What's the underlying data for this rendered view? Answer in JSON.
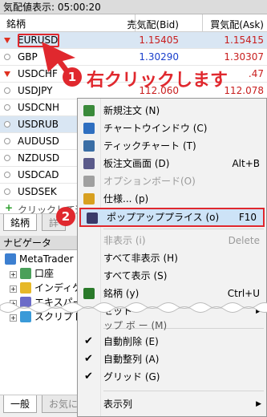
{
  "market_watch": {
    "title": "気配値表示: 05:00:20",
    "columns": [
      "銘柄",
      "売気配(Bid)",
      "買気配(Ask)"
    ],
    "rows": [
      {
        "symbol": "EURUSD",
        "bid": "1.15405",
        "ask": "1.15415",
        "trend": "down",
        "bid_color": "red",
        "ask_color": "red"
      },
      {
        "symbol": "GBP",
        "bid": "1.30290",
        "ask": "1.30307",
        "trend": "neutral",
        "bid_color": "blue",
        "ask_color": "red"
      },
      {
        "symbol": "USDCHF",
        "bid": "",
        "ask": ".47",
        "trend": "down",
        "bid_color": "red",
        "ask_color": "red"
      },
      {
        "symbol": "USDJPY",
        "bid": "112.060",
        "ask": "112.078",
        "trend": "neutral",
        "bid_color": "red",
        "ask_color": "red"
      },
      {
        "symbol": "USDCNH",
        "bid": "",
        "ask": "",
        "trend": "neutral"
      },
      {
        "symbol": "USDRUB",
        "bid": "",
        "ask": "",
        "trend": "neutral"
      },
      {
        "symbol": "AUDUSD",
        "bid": "",
        "ask": "",
        "trend": "neutral"
      },
      {
        "symbol": "NZDUSD",
        "bid": "",
        "ask": "",
        "trend": "neutral"
      },
      {
        "symbol": "USDCAD",
        "bid": "",
        "ask": "",
        "trend": "neutral"
      },
      {
        "symbol": "USDSEK",
        "bid": "",
        "ask": "",
        "trend": "neutral"
      }
    ],
    "add_row": "クリックして追加",
    "tabs": [
      "銘柄",
      "詳"
    ]
  },
  "navigator": {
    "title": "ナビゲータ",
    "items": [
      "MetaTrader 5",
      "口座",
      "インディケー",
      "エキスパー",
      "スクリプト"
    ],
    "tabs": [
      "一般",
      "お気に入"
    ]
  },
  "context_menu": {
    "items": [
      {
        "label": "新規注文 (N)",
        "shortcut": "",
        "icon": "new-order-icon"
      },
      {
        "label": "チャートウインドウ (C)",
        "shortcut": "",
        "icon": "chart-window-icon"
      },
      {
        "label": "ティックチャート (T)",
        "shortcut": "",
        "icon": "tick-chart-icon"
      },
      {
        "label": "板注文画面 (D)",
        "shortcut": "Alt+B",
        "icon": "depth-of-market-icon"
      },
      {
        "label": "オプションボード(O)",
        "shortcut": "",
        "icon": "option-board-icon",
        "disabled": true
      },
      {
        "label": "仕様... (p)",
        "shortcut": "",
        "icon": "specification-icon"
      },
      {
        "label": "ポップアッププライス (o)",
        "shortcut": "F10",
        "icon": "popup-prices-icon",
        "highlighted": true
      },
      {
        "label": "非表示 (i)",
        "shortcut": "Delete",
        "disabled": true
      },
      {
        "label": "すべて非表示 (H)",
        "shortcut": ""
      },
      {
        "label": "すべて表示 (S)",
        "shortcut": ""
      },
      {
        "label": "銘柄 (y)",
        "shortcut": "Ctrl+U",
        "icon": "symbols-icon"
      },
      {
        "label": "セット",
        "shortcut": "",
        "submenu": true
      },
      {
        "label": "自動削除 (E)",
        "shortcut": "",
        "checked": true
      },
      {
        "label": "自動整列 (A)",
        "shortcut": "",
        "checked": true
      },
      {
        "label": "グリッド (G)",
        "shortcut": "",
        "checked": true
      },
      {
        "label": "表示列",
        "shortcut": "",
        "submenu": true
      }
    ],
    "clipped_text": "ップ ボ ー (M)"
  },
  "annotations": {
    "step1": "1",
    "step1_text": "右クリックします",
    "step2": "2"
  },
  "colors": {
    "accent": "#e0282e",
    "bid_red": "#c81e1e",
    "ask_blue": "#1a3fcc",
    "menu_hl": "#cde3f7"
  }
}
